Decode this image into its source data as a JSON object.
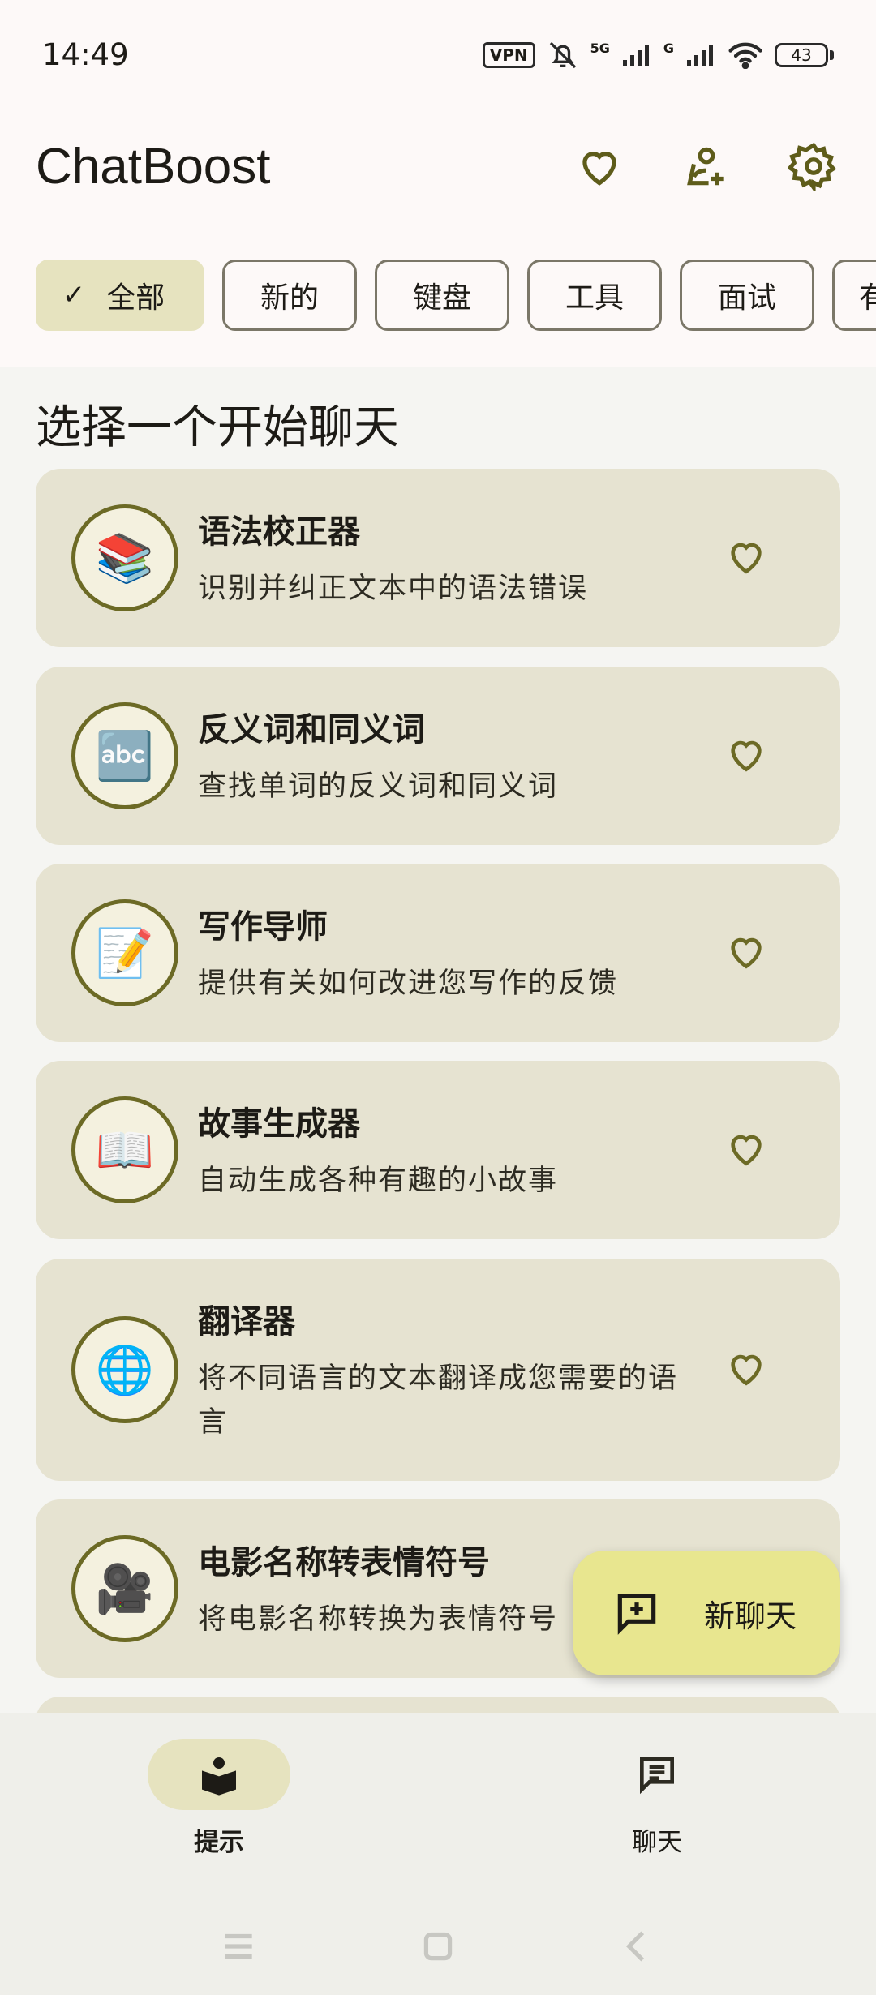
{
  "status_bar": {
    "time": "14:49",
    "vpn": "VPN",
    "network_1": "5G",
    "network_2": "G",
    "battery": "43"
  },
  "app_bar": {
    "title": "ChatBoost",
    "actions": [
      "heart-icon",
      "add-location-icon",
      "gear-icon"
    ]
  },
  "chips": [
    {
      "label": "全部",
      "selected": true
    },
    {
      "label": "新的",
      "selected": false
    },
    {
      "label": "键盘",
      "selected": false
    },
    {
      "label": "工具",
      "selected": false
    },
    {
      "label": "面试",
      "selected": false
    },
    {
      "label": "有",
      "selected": false
    }
  ],
  "section_title": "选择一个开始聊天",
  "prompts": [
    {
      "emoji": "📚",
      "title": "语法校正器",
      "description": "识别并纠正文本中的语法错误"
    },
    {
      "emoji": "🔤",
      "title": "反义词和同义词",
      "description": "查找单词的反义词和同义词"
    },
    {
      "emoji": "📝",
      "title": "写作导师",
      "description": "提供有关如何改进您写作的反馈"
    },
    {
      "emoji": "📖",
      "title": "故事生成器",
      "description": "自动生成各种有趣的小故事"
    },
    {
      "emoji": "🌐",
      "title": "翻译器",
      "description": "将不同语言的文本翻译成您需要的语言"
    },
    {
      "emoji": "🎥",
      "title": "电影名称转表情符号",
      "description": "将电影名称转换为表情符号"
    }
  ],
  "fab": {
    "label": "新聊天"
  },
  "bottom_nav": [
    {
      "label": "提示",
      "active": true
    },
    {
      "label": "聊天",
      "active": false
    }
  ],
  "colors": {
    "accent_chip": "#e6e3bf",
    "card_bg": "#e6e3d1",
    "icon_ring": "#6c6a25",
    "fab_bg": "#e8e68f",
    "heart_stroke": "#6c6a25"
  }
}
